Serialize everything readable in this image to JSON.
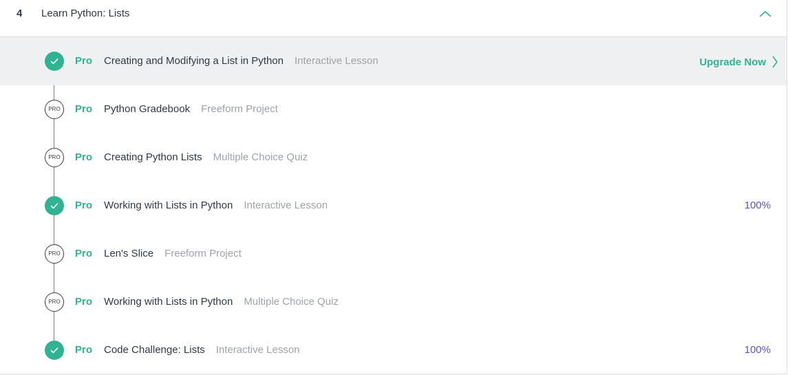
{
  "module": {
    "number": "4",
    "title": "Learn Python: Lists",
    "collapse_icon": "chevron-up-icon"
  },
  "colors": {
    "accent_green": "#2fb392",
    "progress_purple": "#5a4fd6",
    "highlight_row": "#eff0f1",
    "muted_text": "#9ea3a9"
  },
  "pro_label": "Pro",
  "pro_icon_text": "PRO",
  "upgrade": {
    "label": "Upgrade Now",
    "icon": "chevron-right-icon"
  },
  "items": [
    {
      "status": "completed",
      "title": "Creating and Modifying a List in Python",
      "type": "Interactive Lesson",
      "progress": null,
      "upgrade": true
    },
    {
      "status": "locked",
      "title": "Python Gradebook",
      "type": "Freeform Project",
      "progress": null,
      "upgrade": false
    },
    {
      "status": "locked",
      "title": "Creating Python Lists",
      "type": "Multiple Choice Quiz",
      "progress": null,
      "upgrade": false
    },
    {
      "status": "completed",
      "title": "Working with Lists in Python",
      "type": "Interactive Lesson",
      "progress": "100%",
      "upgrade": false
    },
    {
      "status": "locked",
      "title": "Len's Slice",
      "type": "Freeform Project",
      "progress": null,
      "upgrade": false
    },
    {
      "status": "locked",
      "title": "Working with Lists in Python",
      "type": "Multiple Choice Quiz",
      "progress": null,
      "upgrade": false
    },
    {
      "status": "completed",
      "title": "Code Challenge: Lists",
      "type": "Interactive Lesson",
      "progress": "100%",
      "upgrade": false
    }
  ]
}
